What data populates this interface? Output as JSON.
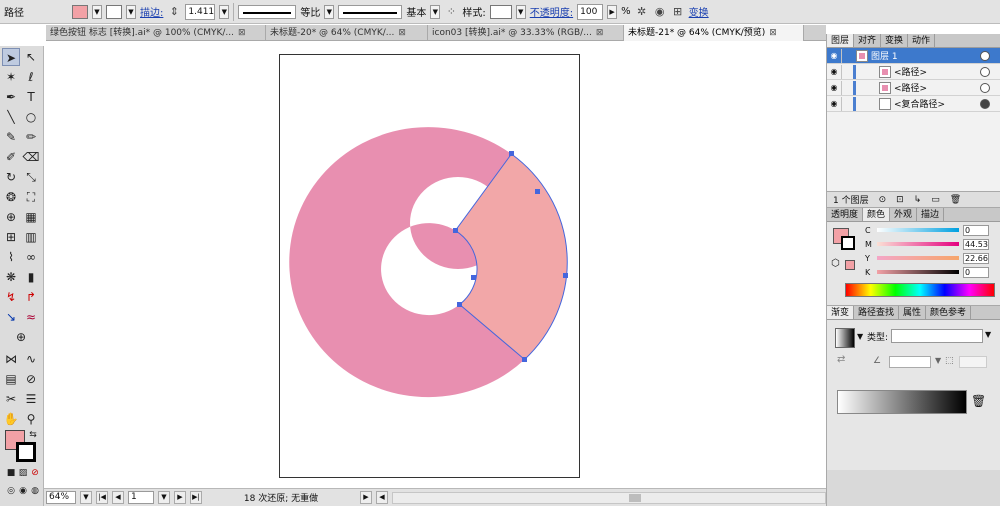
{
  "control_bar": {
    "object_type": "路径",
    "stroke_label": "描边:",
    "stroke_weight": "1.411",
    "profile_label": "等比",
    "brush_label": "基本",
    "style_label": "样式:",
    "opacity_label": "不透明度:",
    "opacity_value": "100",
    "percent": "%",
    "transform_label": "变换"
  },
  "tabs": [
    {
      "title": "绿色按钮 标志 [转换].ai* @ 100% (CMYK/..."
    },
    {
      "title": "未标题-20* @ 64% (CMYK/..."
    },
    {
      "title": "icon03 [转换].ai* @ 33.33% (RGB/..."
    },
    {
      "title": "未标题-21* @ 64% (CMYK/预览)"
    }
  ],
  "status_bar": {
    "zoom": "64%",
    "artboard": "1",
    "history": "18 次还原; 无重做"
  },
  "layers_panel": {
    "tabs": [
      "图层",
      "对齐",
      "变换",
      "动作"
    ],
    "rows": [
      {
        "name": "图层 1"
      },
      {
        "name": "<路径>"
      },
      {
        "name": "<路径>"
      },
      {
        "name": "<复合路径>"
      }
    ],
    "footer": "1 个图层"
  },
  "color_panel": {
    "tabs": [
      "透明度",
      "颜色",
      "外观",
      "描边"
    ],
    "sliders": [
      {
        "label": "C",
        "value": "0"
      },
      {
        "label": "M",
        "value": "44.53"
      },
      {
        "label": "Y",
        "value": "22.66"
      },
      {
        "label": "K",
        "value": "0"
      }
    ]
  },
  "gradient_panel": {
    "tabs": [
      "渐变",
      "路径查找",
      "属性",
      "颜色参考"
    ],
    "type_label": "类型:"
  },
  "colors": {
    "ring_fill": "#e88fb0",
    "segment_fill": "#f2a7a8",
    "fill_swatch": "#f2a1a6",
    "selection": "#4466dd"
  },
  "icons": [
    "selection-tool-icon",
    "pen-tool-icon",
    "type-tool-icon",
    "zoom-tool-icon",
    "hand-tool-icon",
    "eye-icon",
    "target-icon"
  ]
}
